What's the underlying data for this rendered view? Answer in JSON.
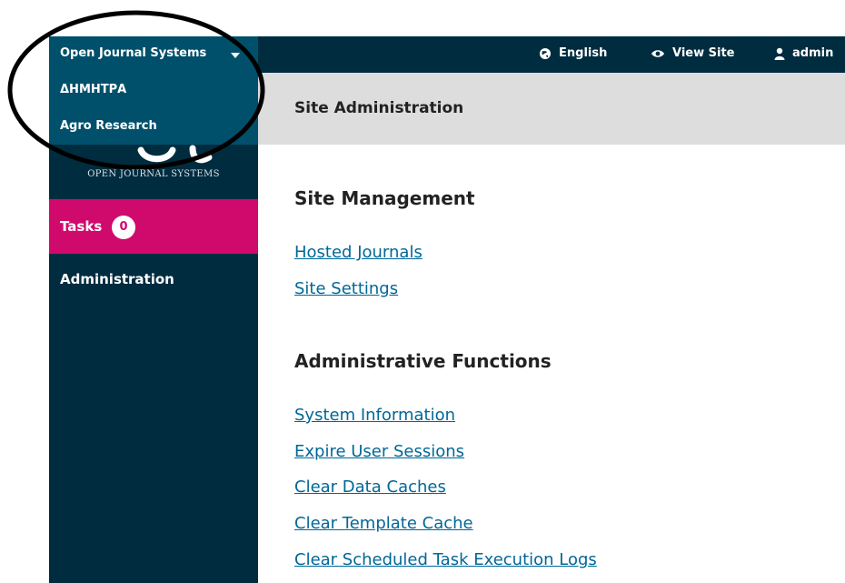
{
  "context_menu": {
    "title": "Open Journal Systems",
    "items": [
      "ΔΗΜΗΤΡΑ",
      "Agro Research"
    ]
  },
  "logo": {
    "caption": "OPEN JOURNAL SYSTEMS"
  },
  "topbar": {
    "language": "English",
    "view_site": "View Site",
    "user": "admin"
  },
  "sidebar": {
    "tasks_label": "Tasks",
    "tasks_count": "0",
    "administration": "Administration"
  },
  "header": {
    "title": "Site Administration"
  },
  "sections": {
    "site_management": {
      "heading": "Site Management",
      "links": [
        "Hosted Journals",
        "Site Settings"
      ]
    },
    "administrative_functions": {
      "heading": "Administrative Functions",
      "links": [
        "System Information",
        "Expire User Sessions",
        "Clear Data Caches",
        "Clear Template Cache",
        "Clear Scheduled Task Execution Logs"
      ]
    }
  },
  "colors": {
    "nav_dark": "#002c40",
    "context_menu": "#00506c",
    "tasks_bg": "#d00a6c",
    "link": "#006798",
    "header_bg": "#dddddd"
  },
  "icons": [
    "caret-down-icon",
    "globe-icon",
    "eye-icon",
    "user-icon"
  ]
}
